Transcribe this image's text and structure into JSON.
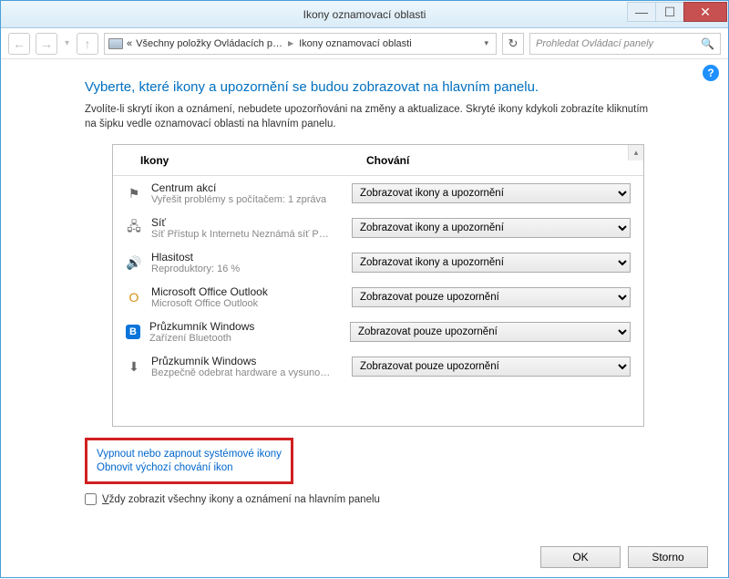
{
  "window": {
    "title": "Ikony oznamovací oblasti"
  },
  "titlebar_buttons": {
    "min": "—",
    "max": "☐",
    "close": "✕"
  },
  "nav": {
    "back": "←",
    "forward": "→",
    "history_chev": "▾",
    "up": "↑",
    "crumb1": "Všechny položky Ovládacích p…",
    "crumb2": "Ikony oznamovací oblasti",
    "dd": "▾",
    "refresh": "↻"
  },
  "search": {
    "placeholder": "Prohledat Ovládací panely",
    "icon": "🔍"
  },
  "help": "?",
  "heading": "Vyberte, které ikony a upozornění se budou zobrazovat na hlavním panelu.",
  "description": "Zvolíte-li skrytí ikon a oznámení, nebudete upozorňováni na změny a aktualizace. Skryté ikony kdykoli zobrazíte kliknutím na šipku vedle oznamovací oblasti na hlavním panelu.",
  "columns": {
    "icons": "Ikony",
    "behavior": "Chování"
  },
  "options": {
    "show_all": "Zobrazovat ikony a upozornění",
    "notify_only": "Zobrazovat pouze upozornění"
  },
  "items": [
    {
      "icon": "⚑",
      "title": "Centrum akcí",
      "subtitle": "Vyřešit problémy s počítačem: 1 zpráva",
      "value": "show_all"
    },
    {
      "icon": "🖧",
      "title": "Síť",
      "subtitle": "Síť Přístup k Internetu  Neznámá síť P…",
      "value": "show_all"
    },
    {
      "icon": "🔊",
      "title": "Hlasitost",
      "subtitle": "Reproduktory: 16 %",
      "value": "show_all"
    },
    {
      "icon": "O",
      "title": "Microsoft Office Outlook",
      "subtitle": "Microsoft Office Outlook",
      "value": "notify_only"
    },
    {
      "icon": "B",
      "title": "Průzkumník Windows",
      "subtitle": "Zařízení Bluetooth",
      "value": "notify_only"
    },
    {
      "icon": "⬇",
      "title": "Průzkumník Windows",
      "subtitle": "Bezpečně odebrat hardware a vysuno…",
      "value": "notify_only"
    }
  ],
  "links": {
    "toggle_system": "Vypnout nebo zapnout systémové ikony",
    "restore_defaults": "Obnovit výchozí chování ikon"
  },
  "checkbox_label": "Vždy zobrazit všechny ikony a oznámení na hlavním panelu",
  "checkbox_underline": "V",
  "buttons": {
    "ok": "OK",
    "cancel": "Storno"
  },
  "scroll": {
    "up": "▴"
  }
}
